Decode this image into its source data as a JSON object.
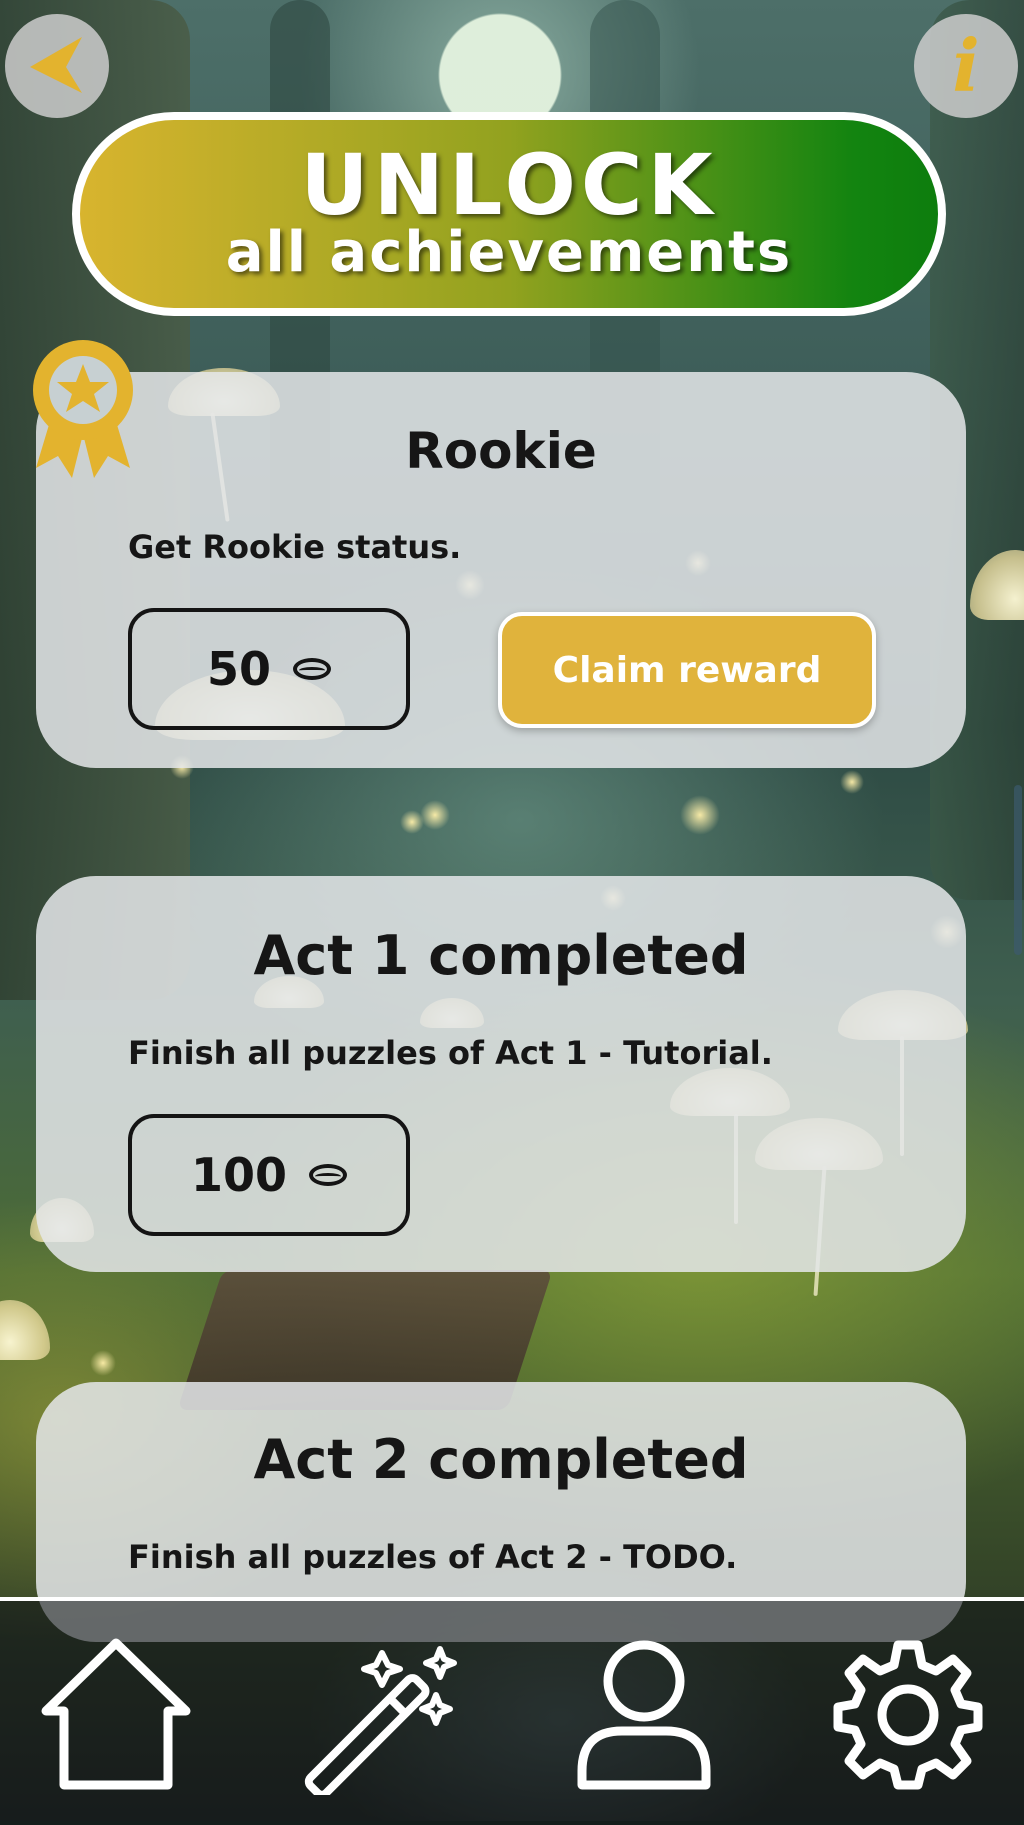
{
  "header": {
    "back_icon": "back-arrow-icon",
    "info_icon": "info-icon",
    "info_glyph": "i"
  },
  "banner": {
    "line1": "UNLOCK",
    "line2": "all achievements",
    "gradient_start": "#d8b42e",
    "gradient_end": "#0d7d0d"
  },
  "achievements": [
    {
      "title": "Rookie",
      "description": "Get Rookie status.",
      "reward": "50",
      "claimable": true,
      "claim_label": "Claim reward",
      "badge_icon": "medal-icon"
    },
    {
      "title": "Act 1 completed",
      "description": "Finish all puzzles of Act 1 - Tutorial.",
      "reward": "100",
      "claimable": false
    },
    {
      "title": "Act 2 completed",
      "description": "Finish all puzzles of Act 2 - TODO."
    }
  ],
  "nav": {
    "items": [
      {
        "icon": "home-icon"
      },
      {
        "icon": "magic-wand-icon"
      },
      {
        "icon": "user-icon"
      },
      {
        "icon": "gear-icon"
      }
    ]
  },
  "colors": {
    "accent_gold": "#e0b33c",
    "card_bg": "#e4e6e9",
    "text_dark": "#161616"
  }
}
